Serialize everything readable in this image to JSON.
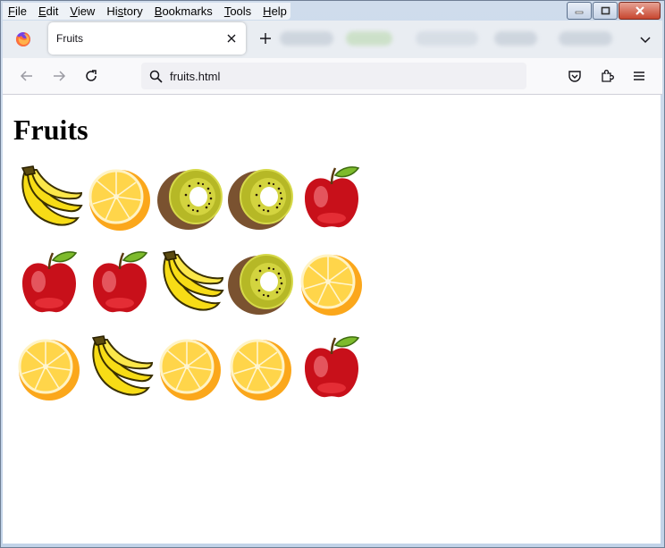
{
  "menu": {
    "items": [
      {
        "pre": "",
        "ul": "F",
        "post": "ile"
      },
      {
        "pre": "",
        "ul": "E",
        "post": "dit"
      },
      {
        "pre": "",
        "ul": "V",
        "post": "iew"
      },
      {
        "pre": "Hi",
        "ul": "s",
        "post": "tory"
      },
      {
        "pre": "",
        "ul": "B",
        "post": "ookmarks"
      },
      {
        "pre": "",
        "ul": "T",
        "post": "ools"
      },
      {
        "pre": "",
        "ul": "H",
        "post": "elp"
      }
    ]
  },
  "tab": {
    "title": "Fruits"
  },
  "address": {
    "url": "fruits.html"
  },
  "page": {
    "heading": "Fruits",
    "fruits": [
      "banana",
      "orange",
      "kiwi",
      "kiwi",
      "apple",
      "apple",
      "apple",
      "banana",
      "kiwi",
      "orange",
      "orange",
      "banana",
      "orange",
      "orange",
      "apple"
    ]
  },
  "colors": {
    "banana": "#f7dc16",
    "orange": "#fba71b",
    "kiwi": "#b6b826",
    "apple": "#c8101a",
    "leaf": "#7dbb2c"
  }
}
